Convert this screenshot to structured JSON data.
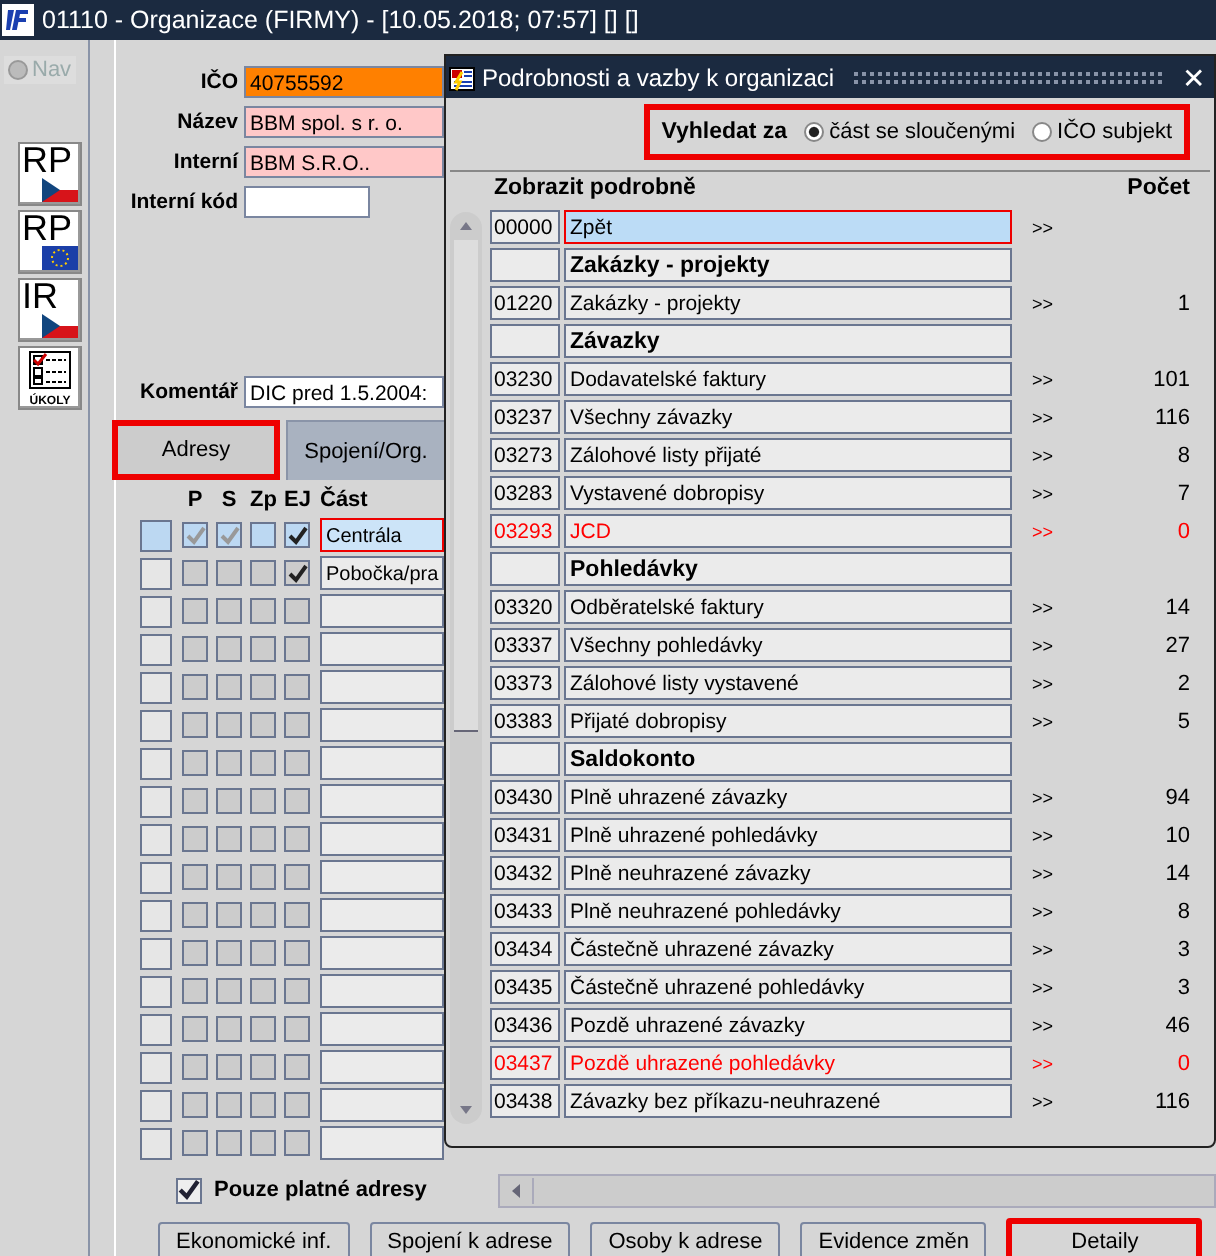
{
  "window": {
    "title": "01110 - Organizace (FIRMY) - [10.05.2018; 07:57] [] []"
  },
  "sidebar": {
    "nav": "Nav",
    "buttons": [
      {
        "kind": "cz",
        "label": "RP"
      },
      {
        "kind": "eu",
        "label": "RP"
      },
      {
        "kind": "cz",
        "label": "IR"
      },
      {
        "kind": "tasks",
        "label": "ÚKOLY"
      }
    ]
  },
  "form": {
    "fields": [
      {
        "kind": "key",
        "label": "IČO",
        "value": "40755592"
      },
      {
        "kind": "name",
        "label": "Název",
        "value": "BBM spol. s r. o."
      },
      {
        "kind": "name",
        "label": "Interní",
        "value": "BBM S.R.O.."
      },
      {
        "kind": "plain",
        "label": "Interní kód"
      }
    ],
    "comment": {
      "label": "Komentář",
      "value": "DIC pred 1.5.2004:"
    }
  },
  "tabs": [
    {
      "label": "Adresy",
      "selected": true,
      "highlighted": true
    },
    {
      "label": "Spojení/Org.",
      "selected": false,
      "highlighted": false
    }
  ],
  "addresses": {
    "columns": [
      "P",
      "S",
      "Zp",
      "EJ",
      "Část"
    ],
    "rows": [
      {
        "selected": true,
        "checks": [
          true,
          true,
          false,
          true
        ],
        "part": "Centrála"
      },
      {
        "selected": false,
        "checks": [
          false,
          false,
          false,
          true
        ],
        "part": "Pobočka/pra"
      },
      {
        "selected": false,
        "checks": [
          false,
          false,
          false,
          false
        ]
      },
      {
        "selected": false,
        "checks": [
          false,
          false,
          false,
          false
        ]
      },
      {
        "selected": false,
        "checks": [
          false,
          false,
          false,
          false
        ]
      },
      {
        "selected": false,
        "checks": [
          false,
          false,
          false,
          false
        ]
      },
      {
        "selected": false,
        "checks": [
          false,
          false,
          false,
          false
        ]
      },
      {
        "selected": false,
        "checks": [
          false,
          false,
          false,
          false
        ]
      },
      {
        "selected": false,
        "checks": [
          false,
          false,
          false,
          false
        ]
      },
      {
        "selected": false,
        "checks": [
          false,
          false,
          false,
          false
        ]
      },
      {
        "selected": false,
        "checks": [
          false,
          false,
          false,
          false
        ]
      },
      {
        "selected": false,
        "checks": [
          false,
          false,
          false,
          false
        ]
      },
      {
        "selected": false,
        "checks": [
          false,
          false,
          false,
          false
        ]
      },
      {
        "selected": false,
        "checks": [
          false,
          false,
          false,
          false
        ]
      },
      {
        "selected": false,
        "checks": [
          false,
          false,
          false,
          false
        ]
      },
      {
        "selected": false,
        "checks": [
          false,
          false,
          false,
          false
        ]
      },
      {
        "selected": false,
        "checks": [
          false,
          false,
          false,
          false
        ]
      }
    ]
  },
  "only_valid": {
    "label": "Pouze platné adresy",
    "checked": true
  },
  "buttons": [
    {
      "label": "Ekonomické inf.",
      "highlighted": false
    },
    {
      "label": "Spojení k adrese",
      "highlighted": false
    },
    {
      "label": "Osoby k adrese",
      "highlighted": false
    },
    {
      "label": "Evidence změn",
      "highlighted": false
    },
    {
      "label": "Detaily",
      "highlighted": true
    }
  ],
  "dialog": {
    "title": "Podrobnosti a vazby k organizaci",
    "close": "✕",
    "search": {
      "label": "Vyhledat za",
      "highlighted": true,
      "options": [
        {
          "label": "část se sloučenými",
          "selected": true
        },
        {
          "label": "IČO subjekt",
          "selected": false
        }
      ]
    },
    "columns": [
      "Zobrazit podrobně",
      "Počet"
    ],
    "rows": [
      {
        "kind": "item",
        "code": "00000",
        "name": "Zpět",
        "arrow": ">>",
        "selected": true,
        "alert": false
      },
      {
        "kind": "group",
        "name": "Zakázky - projekty"
      },
      {
        "kind": "item",
        "code": "01220",
        "name": "Zakázky - projekty",
        "arrow": ">>",
        "count": "1",
        "selected": false,
        "alert": false
      },
      {
        "kind": "group",
        "name": "Závazky"
      },
      {
        "kind": "item",
        "code": "03230",
        "name": "Dodavatelské faktury",
        "arrow": ">>",
        "count": "101",
        "selected": false,
        "alert": false
      },
      {
        "kind": "item",
        "code": "03237",
        "name": "Všechny závazky",
        "arrow": ">>",
        "count": "116",
        "selected": false,
        "alert": false
      },
      {
        "kind": "item",
        "code": "03273",
        "name": "Zálohové listy přijaté",
        "arrow": ">>",
        "count": "8",
        "selected": false,
        "alert": false
      },
      {
        "kind": "item",
        "code": "03283",
        "name": "Vystavené dobropisy",
        "arrow": ">>",
        "count": "7",
        "selected": false,
        "alert": false
      },
      {
        "kind": "item",
        "code": "03293",
        "name": "JCD",
        "arrow": ">>",
        "count": "0",
        "selected": false,
        "alert": true
      },
      {
        "kind": "group",
        "name": "Pohledávky"
      },
      {
        "kind": "item",
        "code": "03320",
        "name": "Odběratelské faktury",
        "arrow": ">>",
        "count": "14",
        "selected": false,
        "alert": false
      },
      {
        "kind": "item",
        "code": "03337",
        "name": "Všechny pohledávky",
        "arrow": ">>",
        "count": "27",
        "selected": false,
        "alert": false
      },
      {
        "kind": "item",
        "code": "03373",
        "name": "Zálohové listy vystavené",
        "arrow": ">>",
        "count": "2",
        "selected": false,
        "alert": false
      },
      {
        "kind": "item",
        "code": "03383",
        "name": "Přijaté dobropisy",
        "arrow": ">>",
        "count": "5",
        "selected": false,
        "alert": false
      },
      {
        "kind": "group",
        "name": "Saldokonto"
      },
      {
        "kind": "item",
        "code": "03430",
        "name": "Plně uhrazené závazky",
        "arrow": ">>",
        "count": "94",
        "selected": false,
        "alert": false
      },
      {
        "kind": "item",
        "code": "03431",
        "name": "Plně uhrazené pohledávky",
        "arrow": ">>",
        "count": "10",
        "selected": false,
        "alert": false
      },
      {
        "kind": "item",
        "code": "03432",
        "name": "Plně neuhrazené závazky",
        "arrow": ">>",
        "count": "14",
        "selected": false,
        "alert": false
      },
      {
        "kind": "item",
        "code": "03433",
        "name": "Plně neuhrazené pohledávky",
        "arrow": ">>",
        "count": "8",
        "selected": false,
        "alert": false
      },
      {
        "kind": "item",
        "code": "03434",
        "name": "Částečně uhrazené závazky",
        "arrow": ">>",
        "count": "3",
        "selected": false,
        "alert": false
      },
      {
        "kind": "item",
        "code": "03435",
        "name": "Částečně uhrazené pohledávky",
        "arrow": ">>",
        "count": "3",
        "selected": false,
        "alert": false
      },
      {
        "kind": "item",
        "code": "03436",
        "name": "Pozdě uhrazené závazky",
        "arrow": ">>",
        "count": "46",
        "selected": false,
        "alert": false
      },
      {
        "kind": "item",
        "code": "03437",
        "name": "Pozdě uhrazené pohledávky",
        "arrow": ">>",
        "count": "0",
        "selected": false,
        "alert": true
      },
      {
        "kind": "item",
        "code": "03438",
        "name": "Závazky bez příkazu-neuhrazené",
        "arrow": ">>",
        "count": "116",
        "selected": false,
        "alert": false
      }
    ]
  }
}
